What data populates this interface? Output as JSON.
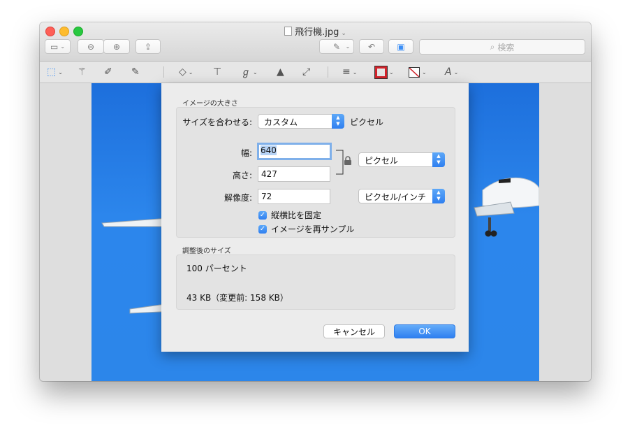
{
  "window": {
    "title": "飛行機.jpg",
    "colors": {
      "close": "#fe5f57",
      "minimize": "#febc2e",
      "zoom": "#28c840",
      "accent": "#3a8ef6"
    }
  },
  "toolbar": {
    "search_placeholder": "検索",
    "icons": [
      "sidebar-icon",
      "zoom-out-icon",
      "zoom-in-icon",
      "share-icon",
      "markup-pen-icon",
      "rotate-icon",
      "toolbox-icon"
    ]
  },
  "markup_toolbar": {
    "icons": [
      "rect-select-icon",
      "magic-wand-icon",
      "sketch-icon",
      "draw-icon",
      "shapes-icon",
      "text-icon",
      "sign-icon",
      "adjust-color-icon",
      "adjust-size-icon",
      "line-style-icon",
      "border-color-icon",
      "fill-color-icon",
      "text-style-icon"
    ]
  },
  "dialog": {
    "section1_label": "イメージの大きさ",
    "fit_label": "サイズを合わせる:",
    "fit_value": "カスタム",
    "fit_unit": "ピクセル",
    "width_label": "幅:",
    "width_value": "640",
    "height_label": "高さ:",
    "height_value": "427",
    "size_unit": "ピクセル",
    "resolution_label": "解像度:",
    "resolution_value": "72",
    "resolution_unit": "ピクセル/インチ",
    "scale_proportionally": "縦横比を固定",
    "resample": "イメージを再サンプル",
    "section2_label": "調整後のサイズ",
    "percent_text": "100 パーセント",
    "filesize_text": "43 KB（変更前: 158 KB）",
    "cancel_label": "キャンセル",
    "ok_label": "OK"
  }
}
